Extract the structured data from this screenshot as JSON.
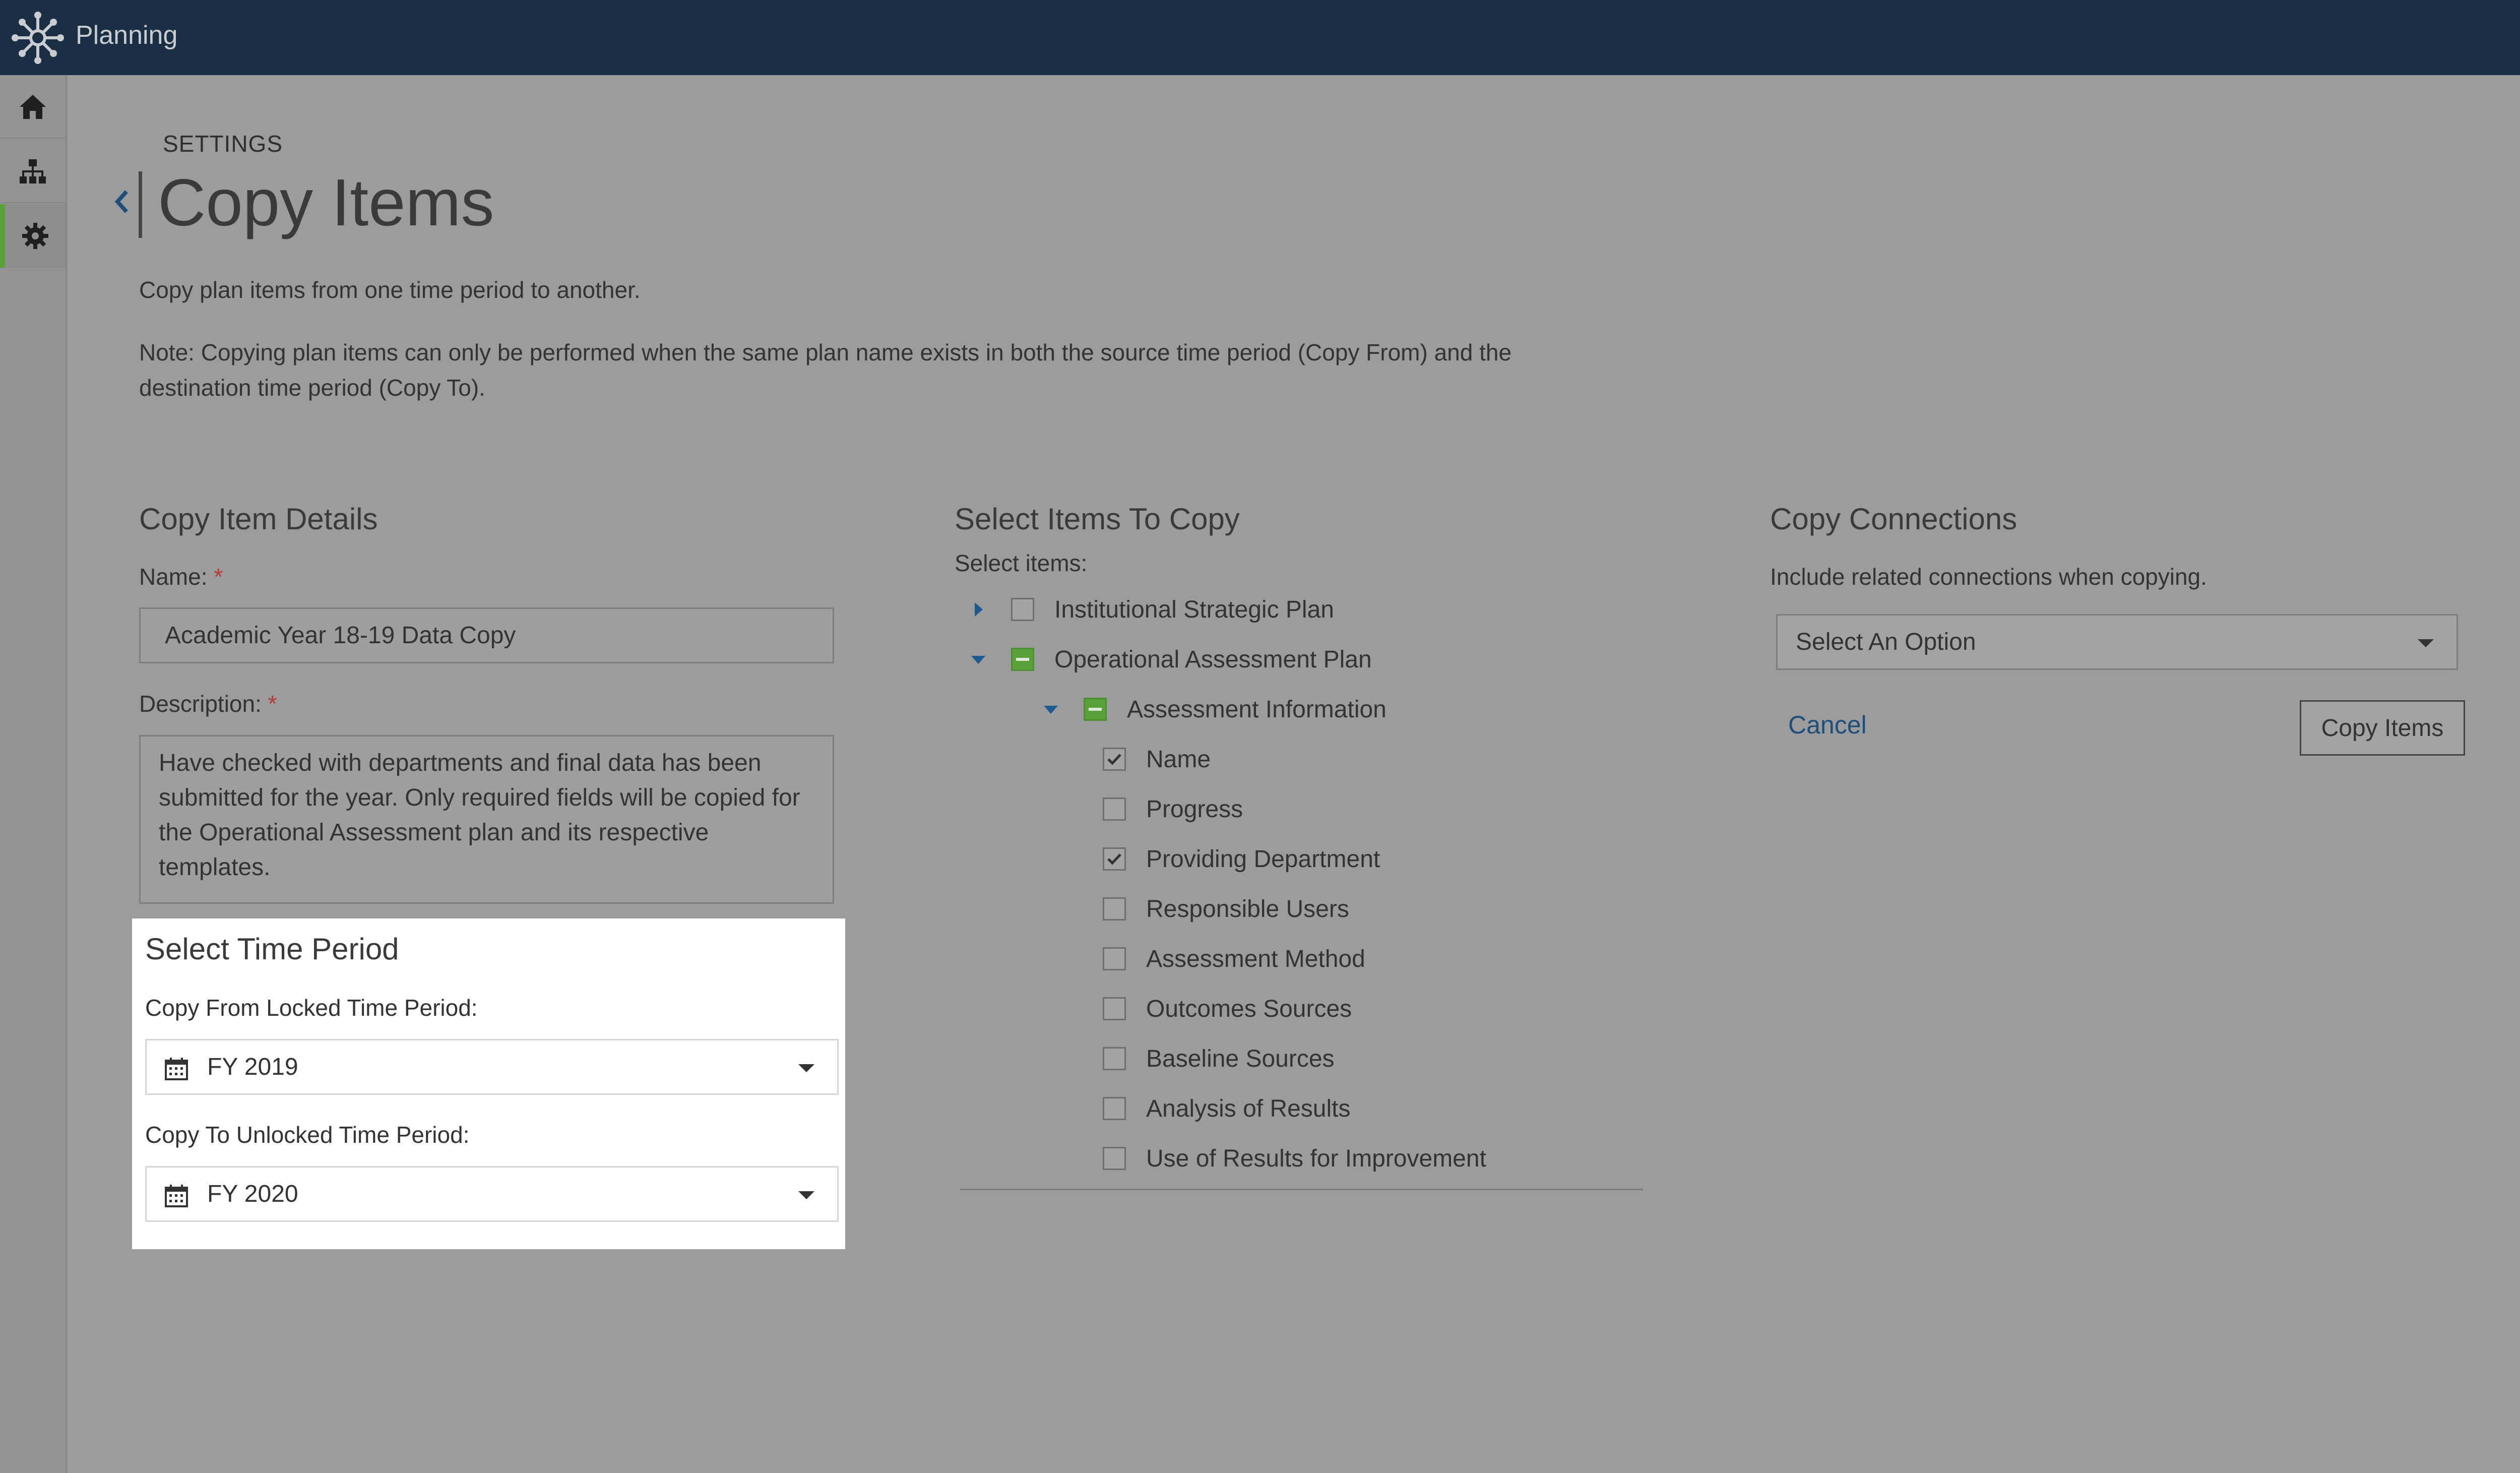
{
  "app": {
    "title": "Planning"
  },
  "sidebar": {
    "items": [
      {
        "name": "home",
        "icon": "home-icon"
      },
      {
        "name": "hierarchy",
        "icon": "org-chart-icon"
      },
      {
        "name": "settings",
        "icon": "gear-icon",
        "active": true
      }
    ]
  },
  "header": {
    "breadcrumb": "SETTINGS",
    "title": "Copy Items"
  },
  "intro": "Copy plan items from one time period to another.",
  "note": "Note: Copying plan items can only be performed when the same plan name exists in both the source time period (Copy From) and the destination time period (Copy To).",
  "details": {
    "heading": "Copy Item Details",
    "name_label": "Name:",
    "name_value": "Academic Year 18-19 Data Copy",
    "description_label": "Description:",
    "description_value": "Have checked with departments and final data has been submitted for the year. Only required fields will be copied for the Operational Assessment plan and its respective templates.",
    "required_mark": "*"
  },
  "time_period": {
    "heading": "Select Time Period",
    "from_label": "Copy From Locked Time Period:",
    "from_value": "FY 2019",
    "to_label": "Copy To Unlocked Time Period:",
    "to_value": "FY 2020"
  },
  "items": {
    "heading": "Select Items To Copy",
    "subheading": "Select items:",
    "tree": [
      {
        "label": "Institutional Strategic Plan",
        "state": "unchecked",
        "expander": "collapsed",
        "level": 0
      },
      {
        "label": "Operational Assessment Plan",
        "state": "partial",
        "expander": "expanded",
        "level": 0
      },
      {
        "label": "Assessment Information",
        "state": "partial",
        "expander": "expanded",
        "level": 1
      },
      {
        "label": "Name",
        "state": "checked",
        "level": 2
      },
      {
        "label": "Progress",
        "state": "unchecked",
        "level": 2
      },
      {
        "label": "Providing Department",
        "state": "checked",
        "level": 2
      },
      {
        "label": "Responsible Users",
        "state": "unchecked",
        "level": 2
      },
      {
        "label": "Assessment Method",
        "state": "unchecked",
        "level": 2
      },
      {
        "label": "Outcomes Sources",
        "state": "unchecked",
        "level": 2
      },
      {
        "label": "Baseline Sources",
        "state": "unchecked",
        "level": 2
      },
      {
        "label": "Analysis of Results",
        "state": "unchecked",
        "level": 2
      },
      {
        "label": "Use of Results for Improvement",
        "state": "unchecked",
        "level": 2
      }
    ]
  },
  "connections": {
    "heading": "Copy Connections",
    "description": "Include related connections when copying.",
    "select_value": "Select An Option",
    "cancel_label": "Cancel",
    "copy_label": "Copy Items"
  },
  "colors": {
    "topbar": "#1b2f44",
    "accent_green": "#5aa13c",
    "link_blue": "#1d4f7a"
  }
}
